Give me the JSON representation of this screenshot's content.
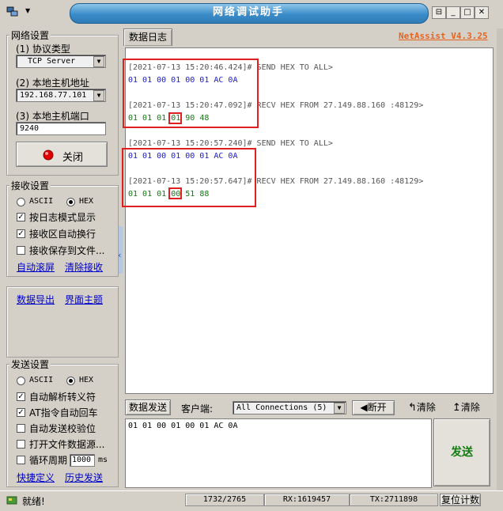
{
  "window": {
    "title": "网络调试助手",
    "brand": "NetAssist V4.3.25",
    "controls": {
      "pin": "⊟",
      "min": "_",
      "max": "□",
      "close": "✕"
    },
    "menu_arrow": "▼"
  },
  "network": {
    "group_title": "网络设置",
    "protocol_label": "(1) 协议类型",
    "protocol_value": "TCP Server",
    "host_label": "(2) 本地主机地址",
    "host_value": "192.168.77.101",
    "port_label": "(3) 本地主机端口",
    "port_value": "9240",
    "close_button": "关闭"
  },
  "receive": {
    "group_title": "接收设置",
    "ascii": "ASCII",
    "hex": "HEX",
    "opt_log_mode": "按日志模式显示",
    "opt_autowrap": "接收区自动换行",
    "opt_save_file": "接收保存到文件...",
    "link_autoscroll": "自动滚屏",
    "link_clear": "清除接收",
    "link_export": "数据导出",
    "link_theme": "界面主题"
  },
  "send_settings": {
    "group_title": "发送设置",
    "ascii": "ASCII",
    "hex": "HEX",
    "opt_escape": "自动解析转义符",
    "opt_at_cr": "AT指令自动回车",
    "opt_checksum": "自动发送校验位",
    "opt_file_src": "打开文件数据源...",
    "opt_loop": "循环周期",
    "loop_value": "1000",
    "loop_unit": "ms",
    "link_shortcut": "快捷定义",
    "link_history": "历史发送"
  },
  "log": {
    "tab": "数据日志",
    "entries": [
      {
        "header": "[2021-07-13 15:20:46.424]# SEND HEX TO ALL>",
        "body": "01 01 00 01 00 01 AC 0A"
      },
      {
        "header": "[2021-07-13 15:20:47.092]# RECV HEX FROM 27.149.88.160 :48129>",
        "body_a": "01 01 01 ",
        "body_hl": "01",
        "body_b": " 90 48"
      },
      {
        "header": "[2021-07-13 15:20:57.240]# SEND HEX TO ALL>",
        "body": "01 01 00 01 00 01 AC 0A"
      },
      {
        "header": "[2021-07-13 15:20:57.647]# RECV HEX FROM 27.149.88.160 :48129>",
        "body_a": "01 01 01 ",
        "body_hl": "00",
        "body_b": " 51 88"
      }
    ]
  },
  "send_panel": {
    "tab": "数据发送",
    "client_label": "客户端:",
    "client_value": "All Connections (5)",
    "disconnect": "断开",
    "clear1": "清除",
    "clear2": "清除",
    "input_value": "01 01 00 01 00 01 AC 0A",
    "send_button": "发送"
  },
  "status": {
    "ready": "就绪!",
    "progress": "1732/2765",
    "rx": "RX:1619457",
    "tx": "TX:2711898",
    "reset": "复位计数"
  },
  "colors": {
    "accent_red": "#e02020",
    "send_text": "#1a1acc",
    "recv_text": "#117a11",
    "brand": "#e8641e"
  }
}
